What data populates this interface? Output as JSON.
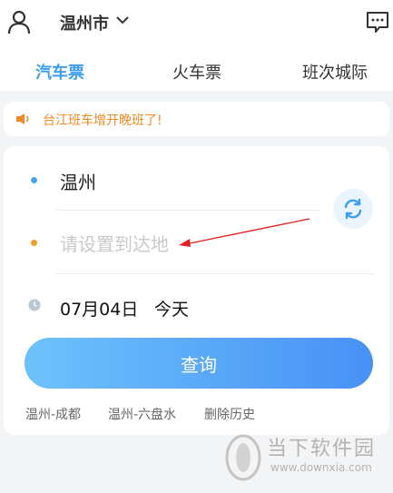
{
  "header": {
    "city": "温州市",
    "tabs": [
      {
        "label": "汽车票",
        "active": true
      },
      {
        "label": "火车票",
        "active": false
      },
      {
        "label": "班次城际",
        "active": false
      }
    ]
  },
  "notice": {
    "text": "台江班车增开晚班了!"
  },
  "search": {
    "from": "温州",
    "to_placeholder": "请设置到达地",
    "date": "07月04日",
    "day": "今天",
    "query_label": "查询"
  },
  "history": {
    "items": [
      "温州-成都",
      "温州-六盘水"
    ],
    "clear_label": "删除历史"
  },
  "watermark": {
    "title": "当下软件园",
    "url": "www.downxia.com"
  },
  "colors": {
    "accent": "#3d9ef0",
    "notice": "#f08a24",
    "button_start": "#6ec2fb",
    "button_end": "#4791f6"
  }
}
